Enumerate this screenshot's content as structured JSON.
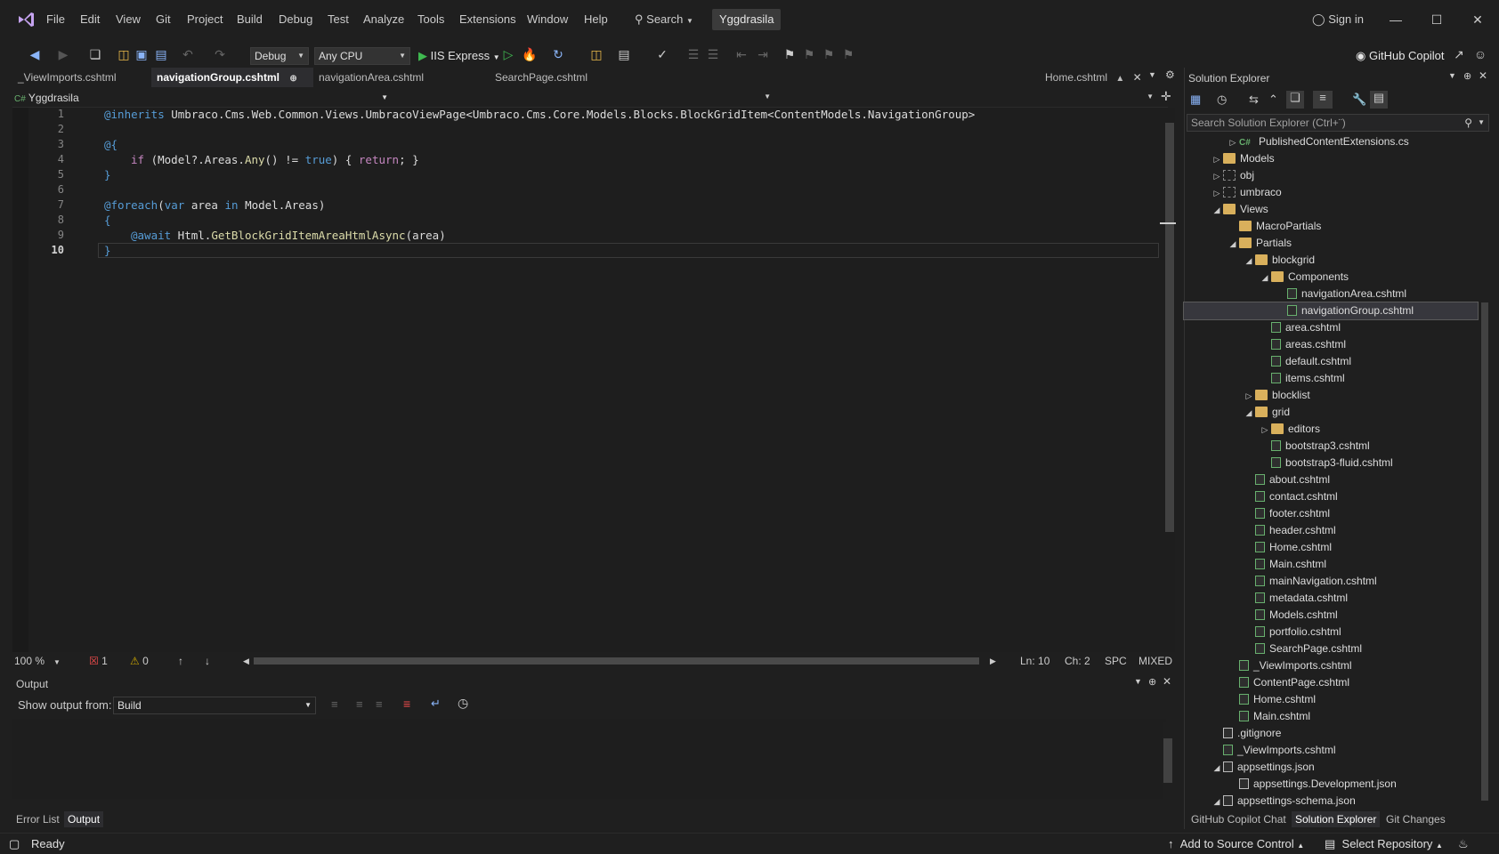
{
  "menu": {
    "items": [
      "File",
      "Edit",
      "View",
      "Git",
      "Project",
      "Build",
      "Debug",
      "Test",
      "Analyze",
      "Tools",
      "Extensions",
      "Window",
      "Help"
    ],
    "search_label": "Search",
    "solution_name": "Yggdrasila",
    "sign_in": "Sign in"
  },
  "toolbar": {
    "config": "Debug",
    "platform": "Any CPU",
    "run_target": "IIS Express",
    "copilot": "GitHub Copilot"
  },
  "tabs": [
    {
      "label": "_ViewImports.cshtml",
      "active": false
    },
    {
      "label": "navigationGroup.cshtml",
      "active": true
    },
    {
      "label": "navigationArea.cshtml",
      "active": false
    },
    {
      "label": "SearchPage.cshtml",
      "active": false
    }
  ],
  "pinned_tab": "Home.cshtml",
  "navbar": {
    "project": "Yggdrasila"
  },
  "editor": {
    "line_numbers": [
      "1",
      "2",
      "3",
      "4",
      "5",
      "6",
      "7",
      "8",
      "9",
      "10"
    ],
    "current_line": "10"
  },
  "code": {
    "l1_inherits": "@inherits",
    "l1_type": " Umbraco.Cms.Web.Common.Views.UmbracoViewPage<Umbraco.Cms.Core.Models.Blocks.BlockGridItem<ContentModels.NavigationGroup>",
    "l3": "@{",
    "l4_if": "if",
    "l4_rest_a": " (Model?.Areas.",
    "l4_any": "Any",
    "l4_rest_b": "() != ",
    "l4_true": "true",
    "l4_rest_c": ") { ",
    "l4_return": "return",
    "l4_rest_d": "; }",
    "l5": "}",
    "l7_foreach": "@foreach",
    "l7_paren": "(",
    "l7_var": "var",
    "l7_mid": " area ",
    "l7_in": "in",
    "l7_end": " Model.Areas)",
    "l8": "{",
    "l9_await": "@await",
    "l9_html": " Html.",
    "l9_method": "GetBlockGridItemAreaHtmlAsync",
    "l9_arg": "(area)",
    "l10": "}"
  },
  "editor_status": {
    "zoom": "100 %",
    "errors": "1",
    "warnings": "0",
    "line": "Ln: 10",
    "char": "Ch: 2",
    "spc": "SPC",
    "eol": "MIXED"
  },
  "output": {
    "title": "Output",
    "show_from_label": "Show output from:",
    "source": "Build"
  },
  "bottom_tabs": [
    "Error List",
    "Output"
  ],
  "solution_explorer": {
    "title": "Solution Explorer",
    "search_placeholder": "Search Solution Explorer (Ctrl+¨)",
    "tree": [
      {
        "label": "PublishedContentExtensions.cs",
        "kind": "cs",
        "twisty": "▷"
      },
      {
        "label": "Models",
        "kind": "folder",
        "twisty": "▷"
      },
      {
        "label": "obj",
        "kind": "folder-dim",
        "twisty": "▷"
      },
      {
        "label": "umbraco",
        "kind": "folder-dim",
        "twisty": "▷"
      },
      {
        "label": "Views",
        "kind": "folder",
        "twisty": "◢"
      },
      {
        "label": "MacroPartials",
        "kind": "folder",
        "twisty": ""
      },
      {
        "label": "Partials",
        "kind": "folder",
        "twisty": "◢"
      },
      {
        "label": "blockgrid",
        "kind": "folder",
        "twisty": "◢"
      },
      {
        "label": "Components",
        "kind": "folder",
        "twisty": "◢"
      },
      {
        "label": "navigationArea.cshtml",
        "kind": "file",
        "twisty": ""
      },
      {
        "label": "navigationGroup.cshtml",
        "kind": "file",
        "twisty": "",
        "selected": true
      },
      {
        "label": "area.cshtml",
        "kind": "file",
        "twisty": ""
      },
      {
        "label": "areas.cshtml",
        "kind": "file",
        "twisty": ""
      },
      {
        "label": "default.cshtml",
        "kind": "file",
        "twisty": ""
      },
      {
        "label": "items.cshtml",
        "kind": "file",
        "twisty": ""
      },
      {
        "label": "blocklist",
        "kind": "folder",
        "twisty": "▷"
      },
      {
        "label": "grid",
        "kind": "folder",
        "twisty": "◢"
      },
      {
        "label": "editors",
        "kind": "folder",
        "twisty": "▷"
      },
      {
        "label": "bootstrap3.cshtml",
        "kind": "file",
        "twisty": ""
      },
      {
        "label": "bootstrap3-fluid.cshtml",
        "kind": "file",
        "twisty": ""
      },
      {
        "label": "about.cshtml",
        "kind": "file",
        "twisty": ""
      },
      {
        "label": "contact.cshtml",
        "kind": "file",
        "twisty": ""
      },
      {
        "label": "footer.cshtml",
        "kind": "file",
        "twisty": ""
      },
      {
        "label": "header.cshtml",
        "kind": "file",
        "twisty": ""
      },
      {
        "label": "Home.cshtml",
        "kind": "file",
        "twisty": ""
      },
      {
        "label": "Main.cshtml",
        "kind": "file",
        "twisty": ""
      },
      {
        "label": "mainNavigation.cshtml",
        "kind": "file",
        "twisty": ""
      },
      {
        "label": "metadata.cshtml",
        "kind": "file",
        "twisty": ""
      },
      {
        "label": "Models.cshtml",
        "kind": "file",
        "twisty": ""
      },
      {
        "label": "portfolio.cshtml",
        "kind": "file",
        "twisty": ""
      },
      {
        "label": "SearchPage.cshtml",
        "kind": "file",
        "twisty": ""
      },
      {
        "label": "_ViewImports.cshtml",
        "kind": "file",
        "twisty": ""
      },
      {
        "label": "ContentPage.cshtml",
        "kind": "file",
        "twisty": ""
      },
      {
        "label": "Home.cshtml",
        "kind": "file",
        "twisty": ""
      },
      {
        "label": "Main.cshtml",
        "kind": "file",
        "twisty": ""
      },
      {
        "label": ".gitignore",
        "kind": "plain",
        "twisty": ""
      },
      {
        "label": "_ViewImports.cshtml",
        "kind": "file",
        "twisty": ""
      },
      {
        "label": "appsettings.json",
        "kind": "json",
        "twisty": "◢"
      },
      {
        "label": "appsettings.Development.json",
        "kind": "json",
        "twisty": ""
      },
      {
        "label": "appsettings-schema.json",
        "kind": "json",
        "twisty": "◢"
      }
    ],
    "bottom_tabs": [
      "GitHub Copilot Chat",
      "Solution Explorer",
      "Git Changes"
    ]
  },
  "statusbar": {
    "ready": "Ready",
    "source_control": "Add to Source Control",
    "repository": "Select Repository"
  }
}
